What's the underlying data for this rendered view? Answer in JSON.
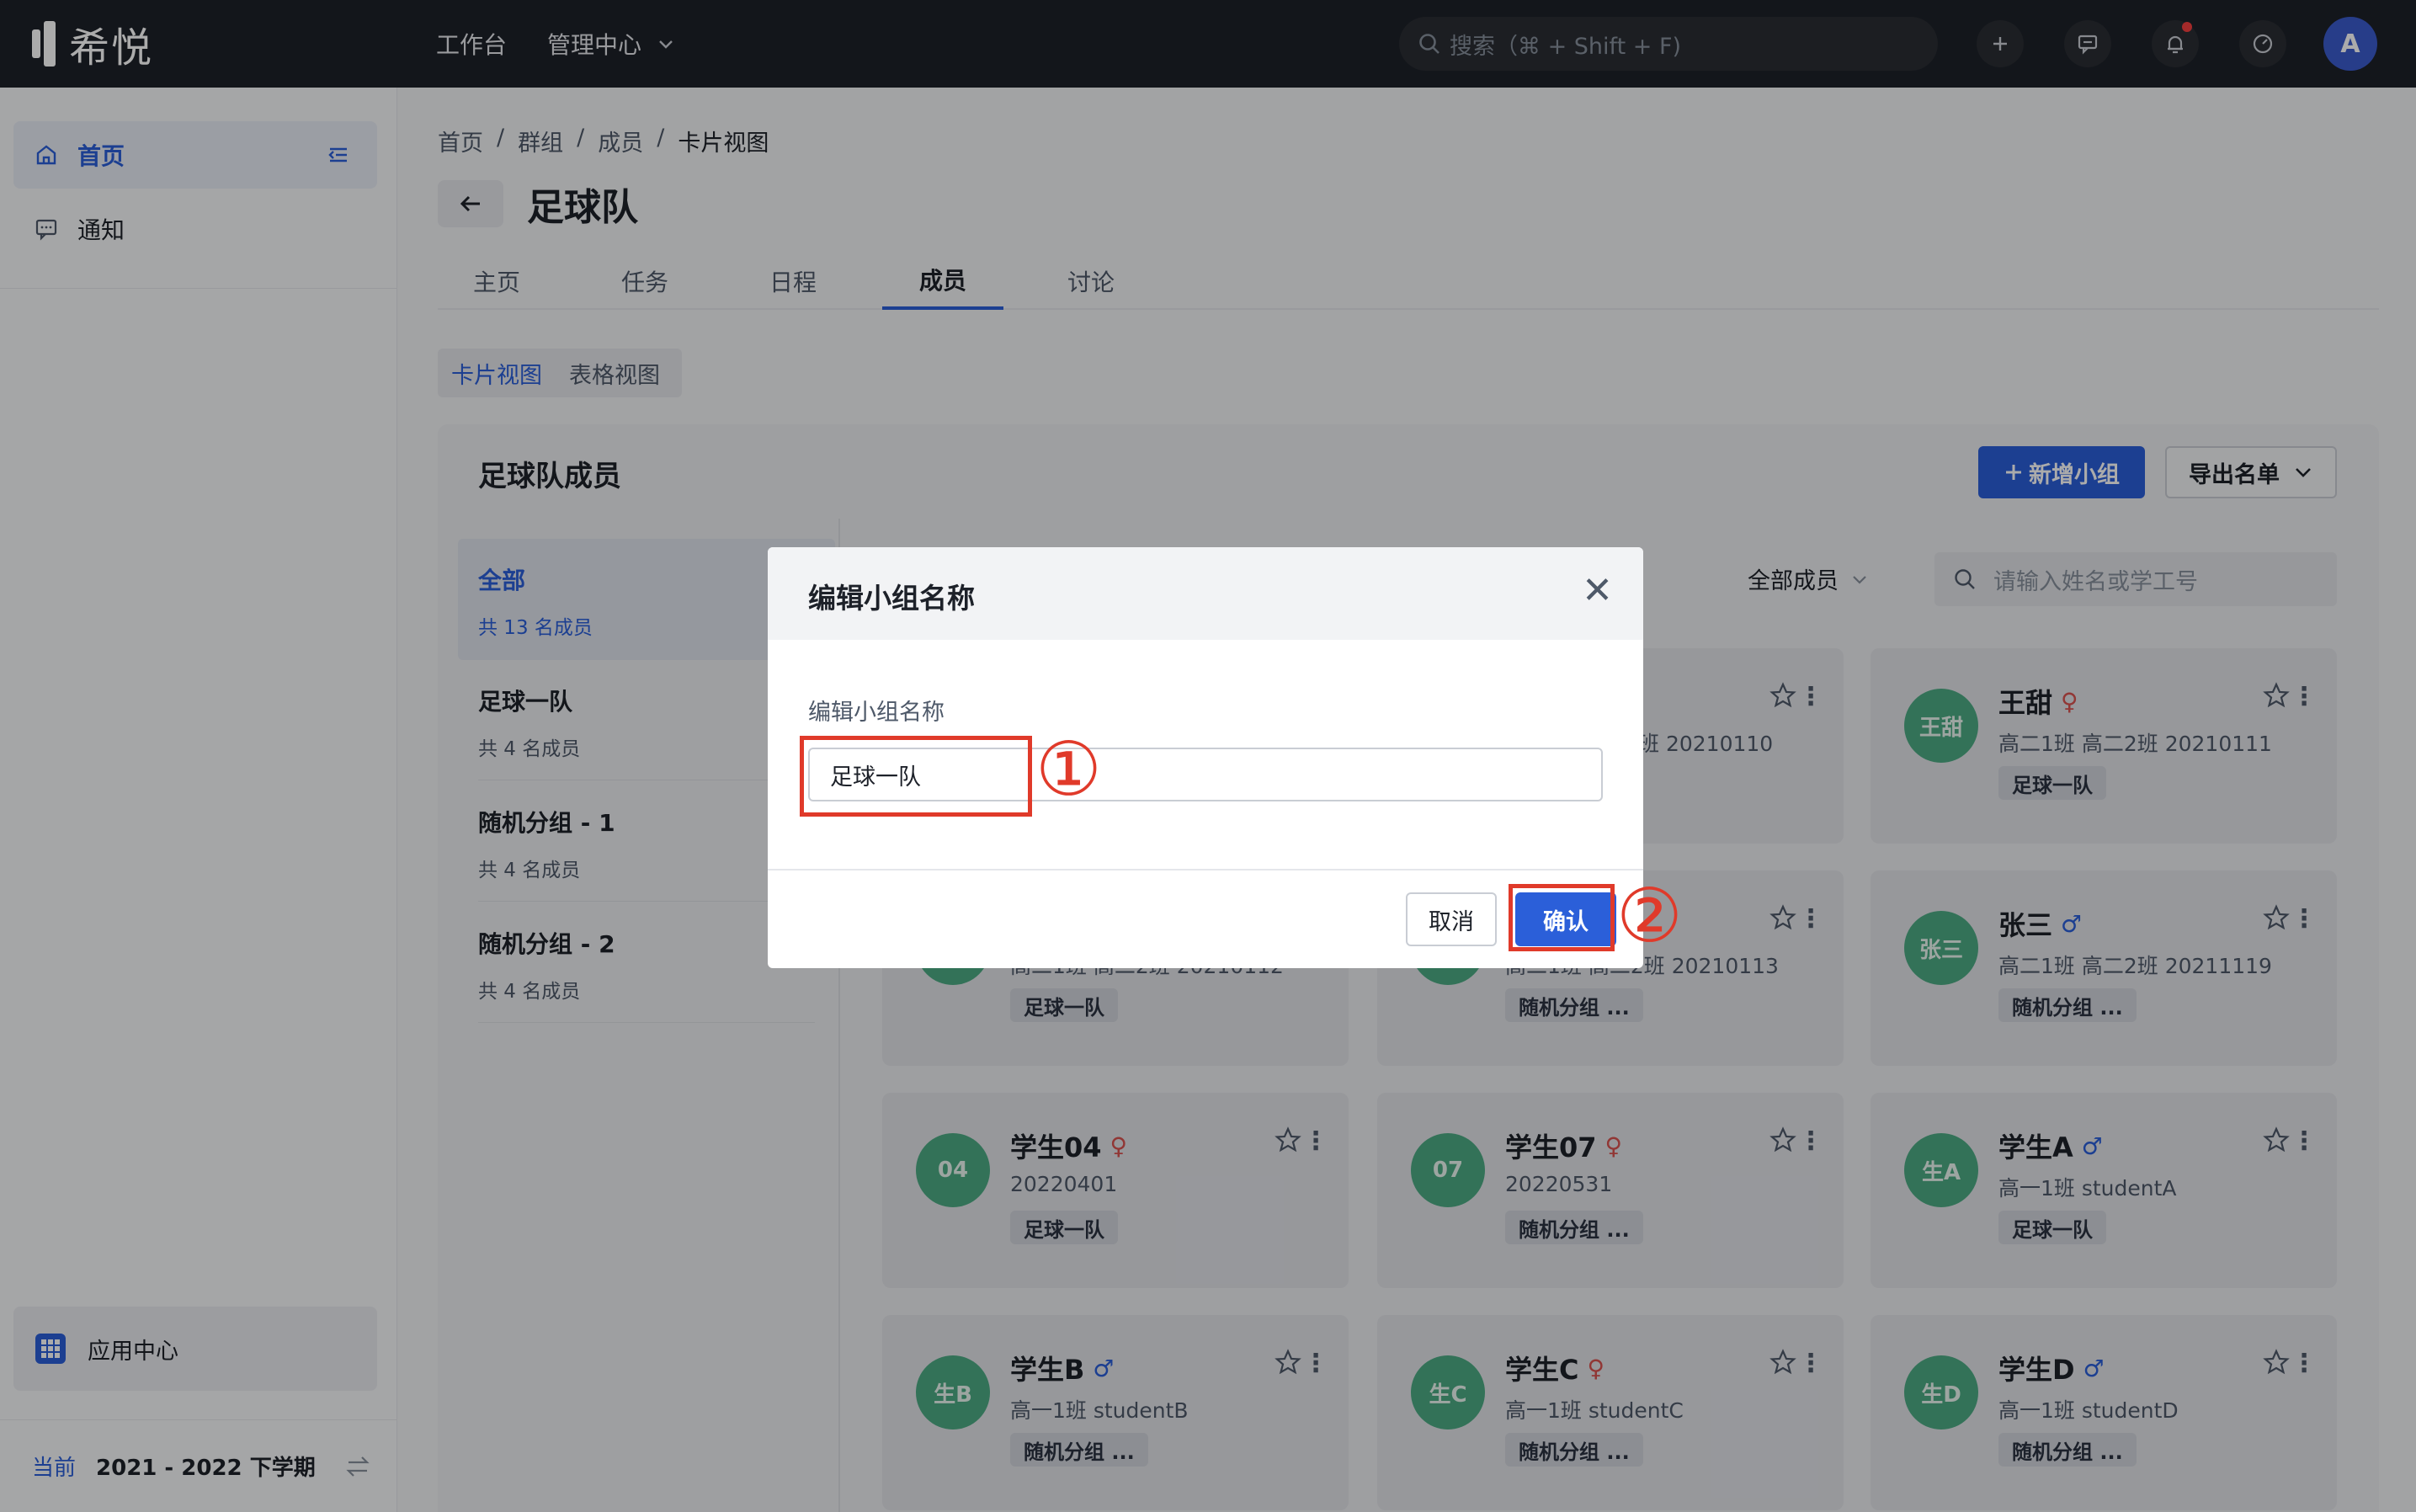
{
  "topbar": {
    "logo_text": "希悦",
    "nav_workbench": "工作台",
    "nav_admin": "管理中心",
    "search_placeholder": "搜索（⌘ + Shift + F)",
    "avatar_letter": "A"
  },
  "sidebar": {
    "home": "首页",
    "notice": "通知",
    "app_center": "应用中心",
    "term_prefix": "当前",
    "term_value": "2021 - 2022 下学期"
  },
  "breadcrumb": [
    "首页",
    "群组",
    "成员",
    "卡片视图"
  ],
  "page_title": "足球队",
  "tabs": [
    "主页",
    "任务",
    "日程",
    "成员",
    "讨论"
  ],
  "active_tab": "成员",
  "view_switch": {
    "card": "卡片视图",
    "table": "表格视图"
  },
  "panel": {
    "title": "足球队成员",
    "add_group_button": "新增小组",
    "export_button": "导出名单",
    "filter_label": "全部成员",
    "search_placeholder": "请输入姓名或学工号"
  },
  "groups": [
    {
      "name": "全部",
      "count": "共 13 名成员"
    },
    {
      "name": "足球一队",
      "count": "共 4 名成员"
    },
    {
      "name": "随机分组 - 1",
      "count": "共 4 名成员"
    },
    {
      "name": "随机分组 - 2",
      "count": "共 4 名成员"
    }
  ],
  "members": [
    {
      "avatar": "",
      "name": "",
      "gender": "",
      "sub": "班 20210110",
      "tag": ""
    },
    {
      "avatar": "王甜",
      "name": "王甜",
      "gender": "♀",
      "sub": "高二1班 高二2班 20210111",
      "tag": "足球一队"
    },
    {
      "avatar": "",
      "name": "",
      "gender": "",
      "sub": "高二1班 高二2班 20210112",
      "tag": "足球一队"
    },
    {
      "avatar": "",
      "name": "",
      "gender": "",
      "sub": "高二1班 高二2班 20210113",
      "tag": "随机分组 ..."
    },
    {
      "avatar": "张三",
      "name": "张三",
      "gender": "♂",
      "sub": "高二1班 高二2班 20211119",
      "tag": "随机分组 ..."
    },
    {
      "avatar": "04",
      "name": "学生04",
      "gender": "♀",
      "sub": "20220401",
      "tag": "足球一队"
    },
    {
      "avatar": "07",
      "name": "学生07",
      "gender": "♀",
      "sub": "20220531",
      "tag": "随机分组 ..."
    },
    {
      "avatar": "生A",
      "name": "学生A",
      "gender": "♂",
      "sub": "高一1班 studentA",
      "tag": "足球一队"
    },
    {
      "avatar": "生B",
      "name": "学生B",
      "gender": "♂",
      "sub": "高一1班 studentB",
      "tag": "随机分组 ..."
    },
    {
      "avatar": "生C",
      "name": "学生C",
      "gender": "♀",
      "sub": "高一1班 studentC",
      "tag": "随机分组 ..."
    },
    {
      "avatar": "生D",
      "name": "学生D",
      "gender": "♂",
      "sub": "高一1班 studentD",
      "tag": "随机分组 ..."
    }
  ],
  "dialog": {
    "title": "编辑小组名称",
    "label": "编辑小组名称",
    "input_value": "足球一队",
    "cancel": "取消",
    "confirm": "确认"
  },
  "annotations": {
    "step1": "①",
    "step2": "②",
    "color": "#e03a2a"
  }
}
